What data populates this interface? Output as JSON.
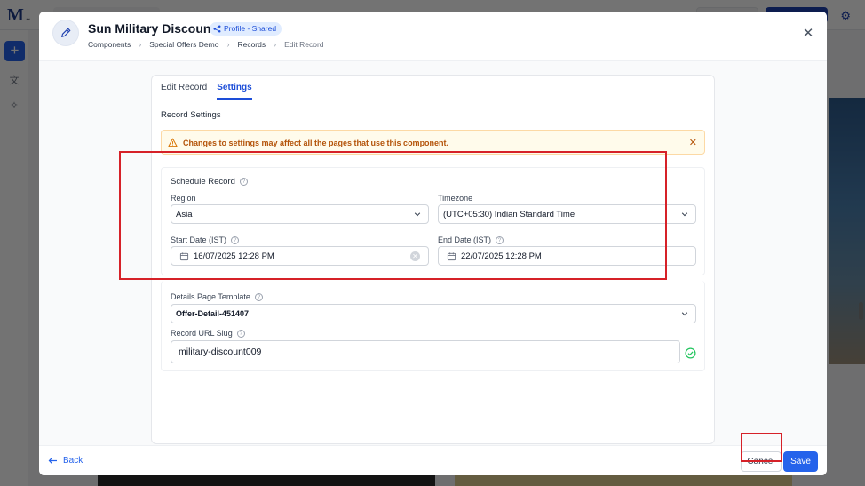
{
  "background": {
    "logo": "M"
  },
  "modal": {
    "title": "Sun Military Discount",
    "badge": "Profile - Shared",
    "breadcrumb": [
      "Components",
      "Special Offers Demo",
      "Records",
      "Edit Record"
    ],
    "tabs": [
      {
        "label": "Edit Record",
        "active": false
      },
      {
        "label": "Settings",
        "active": true
      }
    ],
    "section_title": "Record Settings",
    "alert": "Changes to settings may affect all the pages that use this component.",
    "schedule": {
      "heading": "Schedule Record",
      "region_label": "Region",
      "region_value": "Asia",
      "timezone_label": "Timezone",
      "timezone_value": "(UTC+05:30) Indian Standard Time",
      "start_label": "Start Date (IST)",
      "start_value": "16/07/2025 12:28 PM",
      "end_label": "End Date (IST)",
      "end_value": "22/07/2025 12:28 PM"
    },
    "details": {
      "template_label": "Details Page Template",
      "template_value": "Offer-Detail-451407",
      "slug_label": "Record URL Slug",
      "slug_value": "military-discount009"
    },
    "footer": {
      "back": "Back",
      "cancel": "Cancel",
      "save": "Save"
    }
  },
  "colors": {
    "primary": "#2563eb",
    "warning_text": "#b45309",
    "warning_bg": "#fffbeb",
    "highlight": "#d62128",
    "success": "#22c55e"
  }
}
